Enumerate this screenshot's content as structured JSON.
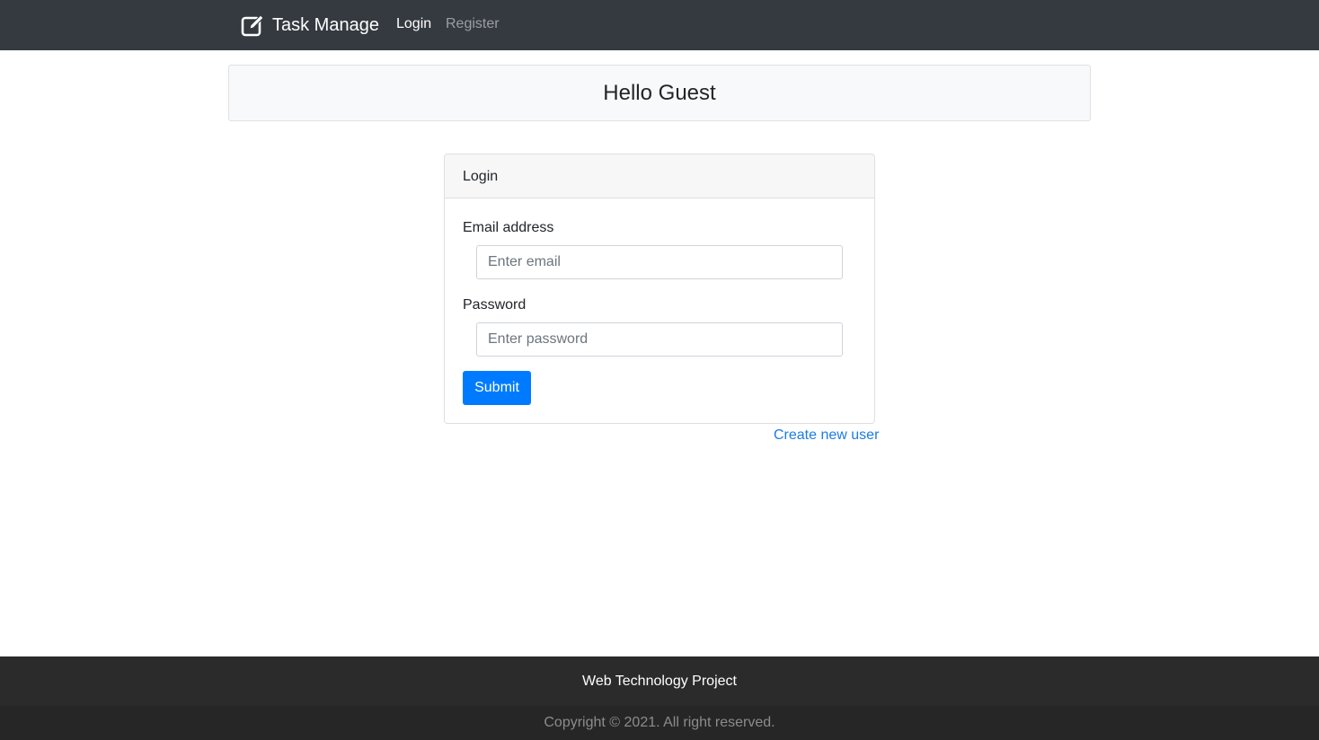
{
  "navbar": {
    "brand_icon": "edit-icon",
    "brand": "Task Manage",
    "links": [
      {
        "label": "Login",
        "active": true
      },
      {
        "label": "Register",
        "active": false
      }
    ]
  },
  "header": {
    "title": "Hello Guest"
  },
  "login_card": {
    "title": "Login",
    "email_label": "Email address",
    "email_placeholder": "Enter email",
    "password_label": "Password",
    "password_placeholder": "Enter password",
    "submit_label": "Submit"
  },
  "create_user_link": "Create new user",
  "footer": {
    "title": "Web Technology Project",
    "copyright": "Copyright © 2021. All right reserved."
  },
  "colors": {
    "navbar": "#343a40",
    "primary": "#007bff",
    "link": "#1a7be6",
    "footer": "#2b2b2b"
  }
}
